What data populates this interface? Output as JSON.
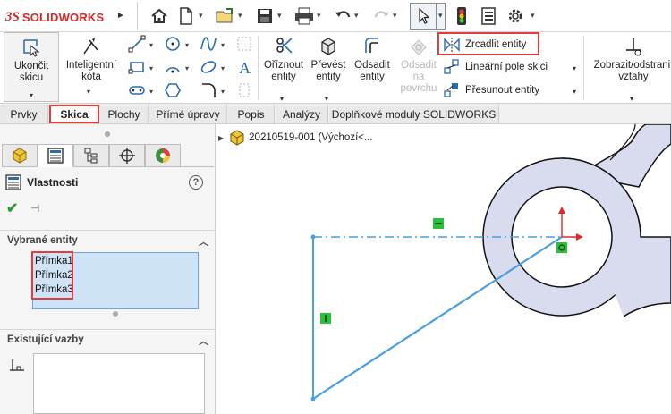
{
  "app": {
    "logo_prefix": "3S",
    "logo_text": "SOLIDWORKS"
  },
  "toolbar": {
    "icons": [
      "home-icon",
      "new-document-icon",
      "open-icon",
      "save-icon",
      "print-icon",
      "undo-icon",
      "redo-icon",
      "select-icon",
      "rebuild-icon",
      "file-properties-icon",
      "options-gear-icon"
    ]
  },
  "ribbon": {
    "exit_sketch": "Ukončit\nskicu",
    "smart_dimension": "Inteligentní\nkóta",
    "trim_entities": "Oříznout\nentity",
    "convert_entities": "Převést\nentity",
    "offset_entities": "Odsadit\nentity",
    "offset_on_surface": "Odsadit\nna\npovrchu",
    "mirror_entities": "Zrcadlit entity",
    "linear_pattern": "Lineární pole skici",
    "move_entities": "Přesunout entity",
    "display_delete_relations": "Zobrazit/odstranit\nvztahy"
  },
  "tabs": [
    {
      "label": "Prvky",
      "active": false
    },
    {
      "label": "Skica",
      "active": true
    },
    {
      "label": "Plochy",
      "active": false
    },
    {
      "label": "Přímé úpravy",
      "active": false
    },
    {
      "label": "Popis",
      "active": false
    },
    {
      "label": "Analýzy",
      "active": false
    },
    {
      "label": "Doplňkové moduly SOLIDWORKS",
      "active": false
    }
  ],
  "panel": {
    "title": "Vlastnosti",
    "help_symbol": "?",
    "selected_section": "Vybrané entity",
    "selected_items": [
      "Přímka1",
      "Přímka2",
      "Přímka3"
    ],
    "existing_section": "Existující vazby"
  },
  "canvas": {
    "tree_label": "20210519-001  (Výchozí<...",
    "colors": {
      "sketch_line": "#4a9fe0",
      "part_face": "#d9dcef",
      "relation_marker": "#2dbf3a",
      "highlight": "#e53b3b"
    }
  }
}
